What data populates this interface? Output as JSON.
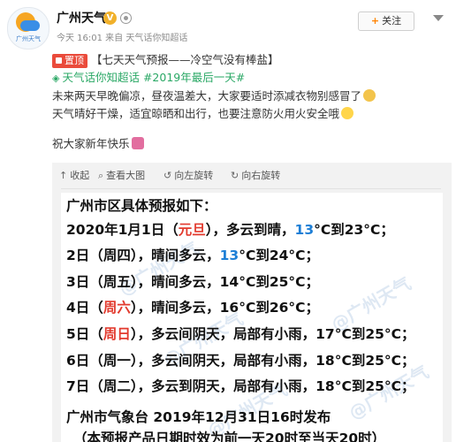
{
  "account": {
    "name": "广州天气",
    "verified_badge": "V",
    "avatar_caption": "广州天气",
    "meta": "今天 16:01 来自 天气话你知超话",
    "follow_label": "关注",
    "follow_plus": "+"
  },
  "post": {
    "pin_label": "置顶",
    "title": "【七天天气预报——冷空气没有棒盐】",
    "topic_line": "天气话你知超话 #2019年最后一天#",
    "line1": "未来两天早晚偏凉，昼夜温差大，大家要适时添减衣物别感冒了",
    "line2": "天气晴好干燥，适宜晾晒和出行，也要注意防火用火安全哦",
    "line3": "祝大家新年快乐"
  },
  "toolbar": {
    "collapse": "收起",
    "view_large": "查看大图",
    "rotate_left": "向左旋转",
    "rotate_right": "向右旋转"
  },
  "forecast": {
    "heading": "广州市区具体预报如下：",
    "days": [
      {
        "pre": "2020年1月1日",
        "paren_open": "（",
        "holiday": "元旦",
        "paren_close": "）",
        "weather": "，多云到晴，",
        "low": "13",
        "rest": "°C到23°C；"
      },
      {
        "pre": "2日",
        "paren_open": "（",
        "holiday": "周四",
        "paren_close": "）",
        "weather": "，晴间多云，",
        "low": "13",
        "rest": "°C到24°C；"
      },
      {
        "pre": "3日",
        "paren_open": "（",
        "holiday": "周五",
        "paren_close": "）",
        "weather": "，晴间多云，",
        "low": "14",
        "rest": "°C到25°C；"
      },
      {
        "pre": "4日",
        "paren_open": "（",
        "holiday": "周六",
        "paren_close": "）",
        "weather": "，晴间多云，",
        "low": "16",
        "rest": "°C到26°C；"
      },
      {
        "pre": "5日",
        "paren_open": "（",
        "holiday": "周日",
        "paren_close": "）",
        "weather": "，多云间阴天，局部有小雨，",
        "low": "17",
        "rest": "°C到25°C；"
      },
      {
        "pre": "6日",
        "paren_open": "（",
        "holiday": "周一",
        "paren_close": "）",
        "weather": "，多云间阴天，局部有小雨，",
        "low": "18",
        "rest": "°C到25°C；"
      },
      {
        "pre": "7日",
        "paren_open": "（",
        "holiday": "周二",
        "paren_close": "）",
        "weather": "，多云到阴天，局部有小雨，",
        "low": "18",
        "rest": "°C到25°C；"
      }
    ],
    "footer1": "广州市气象台 2019年12月31日16时发布",
    "footer2": "（本预报产品日期时效为前一天20时至当天20时）",
    "watermark": "@广州天气"
  },
  "colors": {
    "accent_orange": "#ff8200",
    "pin_red": "#ea4b3b",
    "topic_green": "#2aa865",
    "highlight_red": "#e23a2e",
    "highlight_blue": "#1e7fd6"
  }
}
